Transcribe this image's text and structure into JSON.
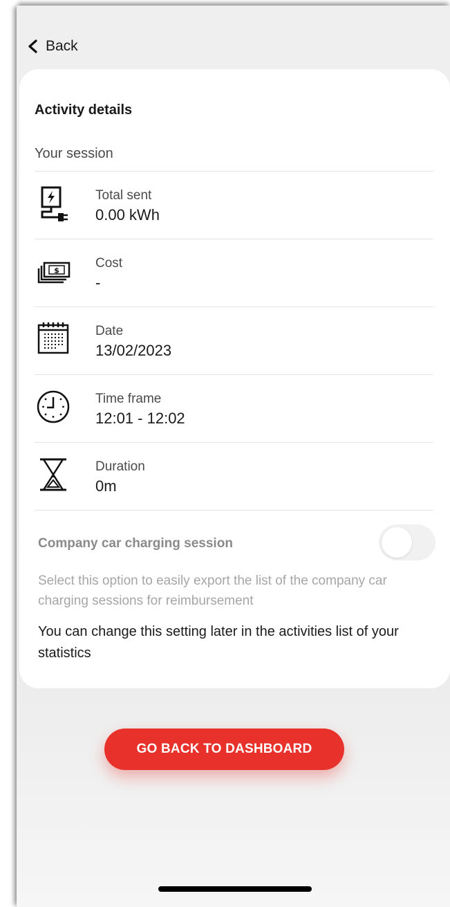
{
  "nav": {
    "back_label": "Back"
  },
  "card": {
    "title": "Activity details",
    "section_label": "Your session",
    "rows": [
      {
        "icon": "charger-icon",
        "label": "Total sent",
        "value": "0.00 kWh"
      },
      {
        "icon": "money-icon",
        "label": "Cost",
        "value": "-"
      },
      {
        "icon": "calendar-icon",
        "label": "Date",
        "value": "13/02/2023"
      },
      {
        "icon": "clock-icon",
        "label": "Time frame",
        "value": "12:01 - 12:02"
      },
      {
        "icon": "hourglass-icon",
        "label": "Duration",
        "value": "0m"
      }
    ],
    "company_car": {
      "label": "Company car charging session",
      "enabled": false,
      "description": "Select this option to easily export the list of the company car charging sessions for reimbursement"
    },
    "note": "You can change this setting later in the activities list of your statistics"
  },
  "cta": {
    "label": "GO BACK TO DASHBOARD"
  },
  "colors": {
    "accent": "#e8312b",
    "card_bg": "#ffffff",
    "page_bg": "#efefef"
  }
}
